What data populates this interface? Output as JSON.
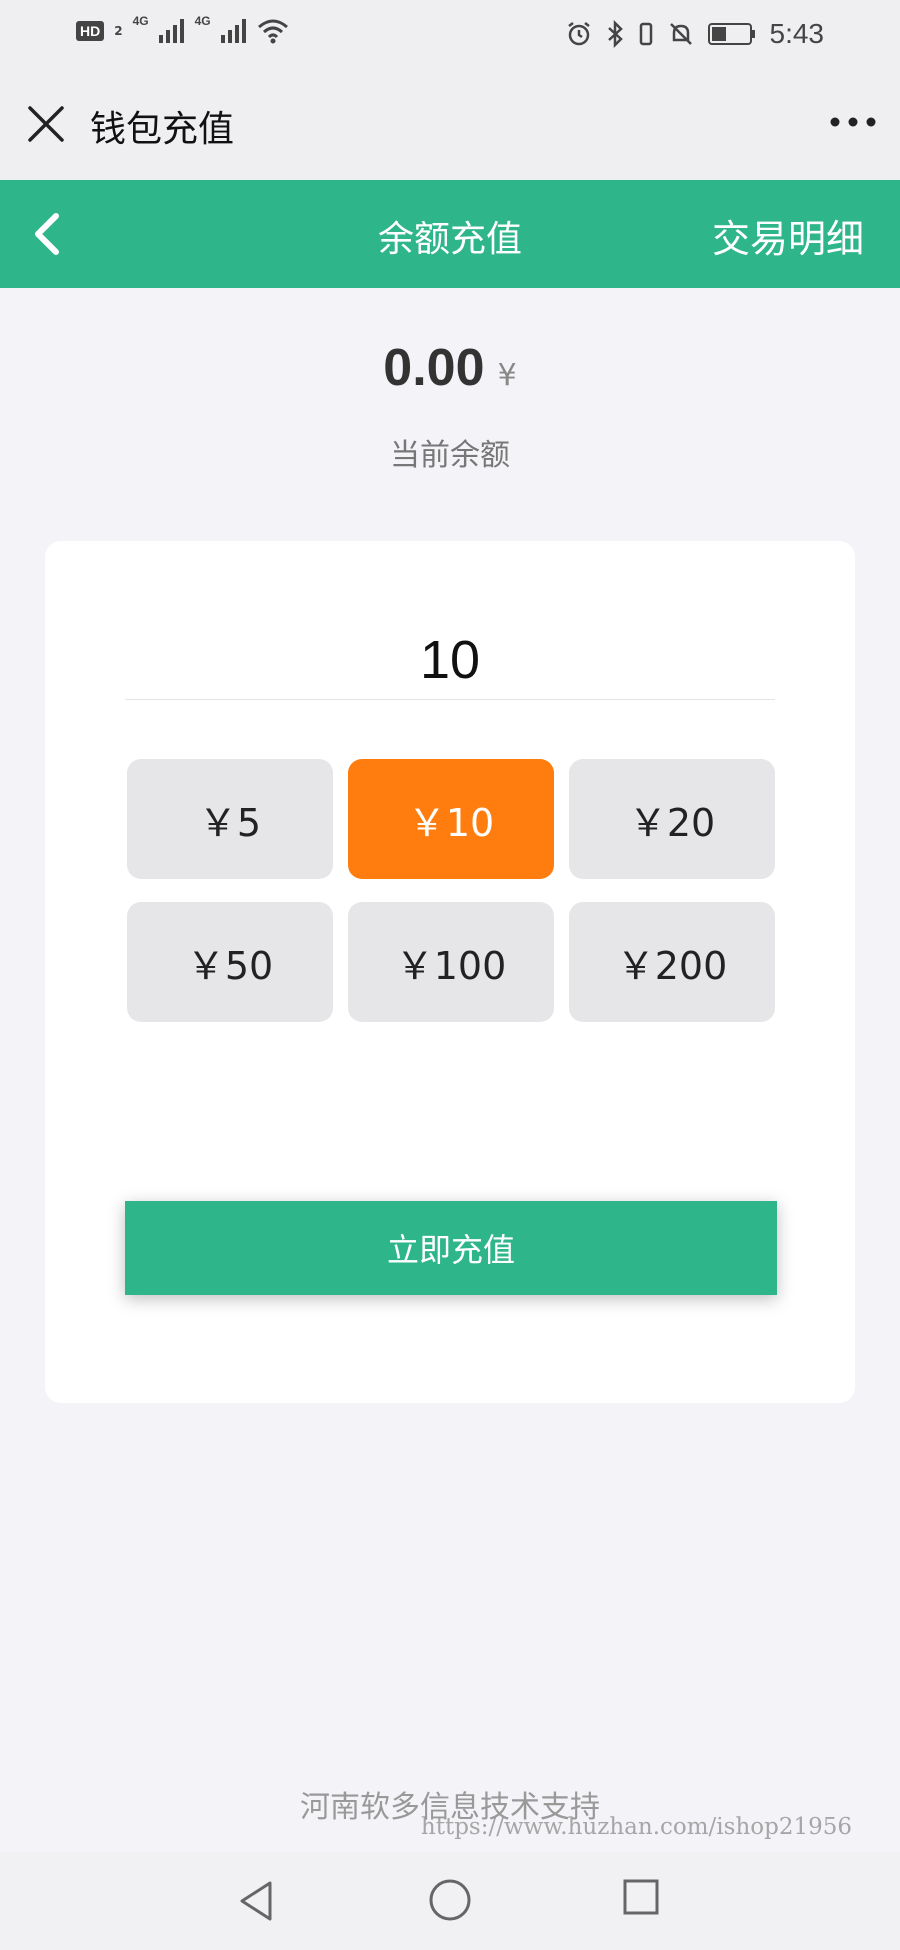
{
  "status_bar": {
    "hd": "HD",
    "hd_sub": "2",
    "net1": "4G",
    "net2": "4G",
    "time": "5:43"
  },
  "title_bar": {
    "title": "钱包充值"
  },
  "header": {
    "title": "余额充值",
    "right_link": "交易明细"
  },
  "balance": {
    "amount": "0.00",
    "currency": "¥",
    "label": "当前余额"
  },
  "recharge": {
    "input_value": "10",
    "options": [
      {
        "label": "￥5",
        "selected": false
      },
      {
        "label": "￥10",
        "selected": true
      },
      {
        "label": "￥20",
        "selected": false
      },
      {
        "label": "￥50",
        "selected": false
      },
      {
        "label": "￥100",
        "selected": false
      },
      {
        "label": "￥200",
        "selected": false
      }
    ],
    "submit_label": "立即充值"
  },
  "footer": {
    "text": "河南软多信息技术支持",
    "watermark": "https://www.huzhan.com/ishop21956"
  },
  "colors": {
    "brand_green": "#2eb589",
    "selected_orange": "#ff7d0f"
  }
}
